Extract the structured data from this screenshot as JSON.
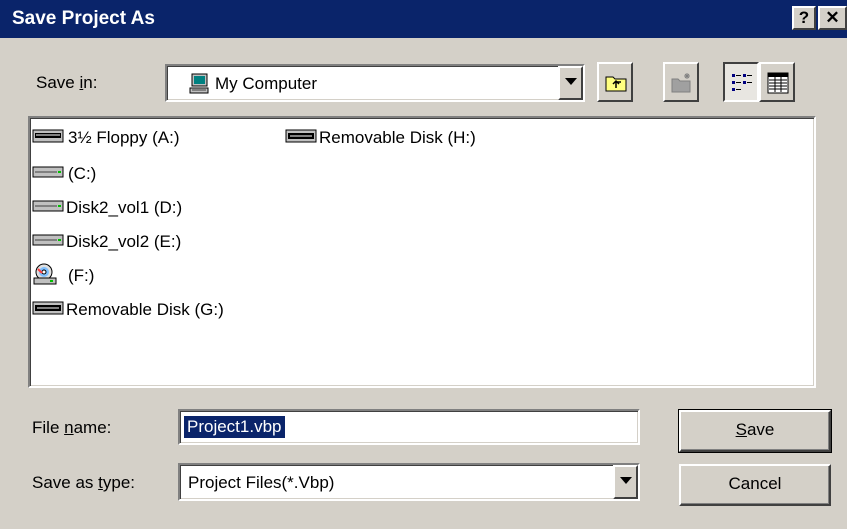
{
  "dialog": {
    "title": "Save Project As",
    "help_label": "?",
    "close_label": "✕"
  },
  "save_in": {
    "label_prefix": "Save ",
    "label_mnemonic": "i",
    "label_suffix": "n:",
    "value": "My Computer"
  },
  "toolbar": {
    "up_folder_icon": "up-one-level-icon",
    "new_folder_icon": "create-new-folder-icon",
    "list_view_icon": "list-view-icon",
    "details_view_icon": "details-view-icon"
  },
  "files": [
    {
      "name": "3½ Floppy (A:)",
      "icon": "floppy-drive-icon"
    },
    {
      "name": "(C:)",
      "icon": "hard-drive-icon"
    },
    {
      "name": "Disk2_vol1 (D:)",
      "icon": "hard-drive-icon"
    },
    {
      "name": "Disk2_vol2 (E:)",
      "icon": "hard-drive-icon"
    },
    {
      "name": "(F:)",
      "icon": "cd-drive-icon"
    },
    {
      "name": "Removable Disk (G:)",
      "icon": "removable-drive-icon"
    },
    {
      "name": "Removable Disk (H:)",
      "icon": "removable-drive-icon"
    }
  ],
  "file_name": {
    "label_prefix": "File ",
    "label_mnemonic": "n",
    "label_suffix": "ame:",
    "value": "Project1.vbp"
  },
  "save_as_type": {
    "label_prefix": "Save as ",
    "label_mnemonic": "t",
    "label_suffix": "ype:",
    "value": "Project Files(*.Vbp)"
  },
  "buttons": {
    "save_mnemonic": "S",
    "save_rest": "ave",
    "cancel": "Cancel"
  }
}
